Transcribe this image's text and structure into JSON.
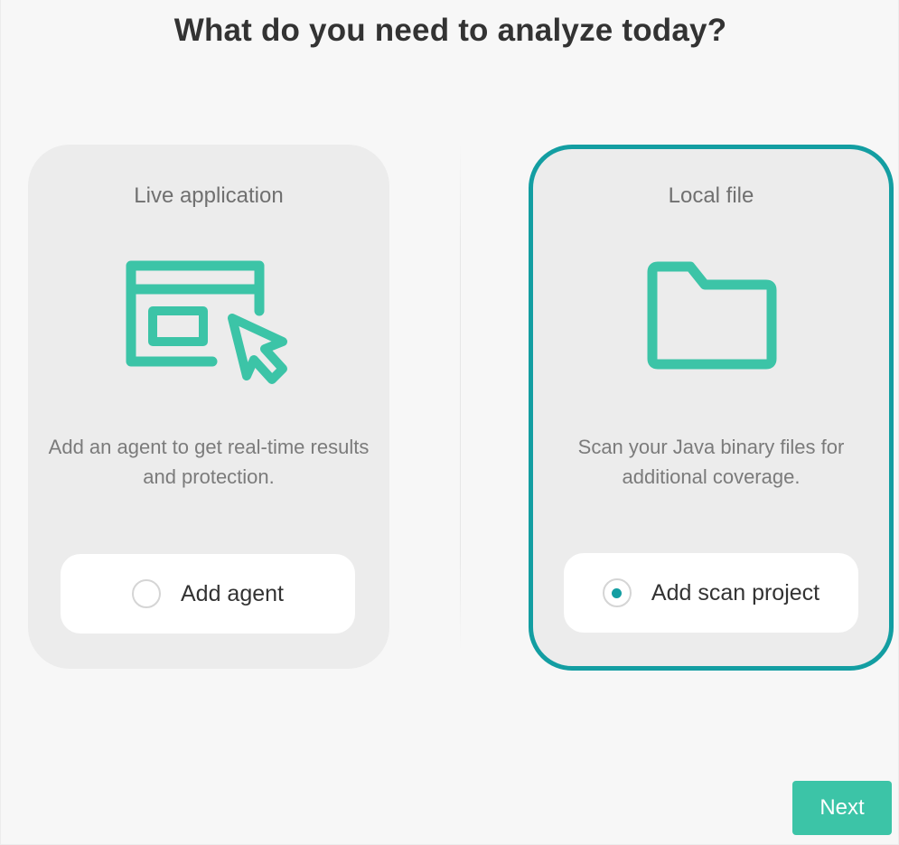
{
  "page": {
    "heading": "What do you need to analyze today?"
  },
  "colors": {
    "accent": "#3cc4a7",
    "selected_border": "#139ea2",
    "card_background": "#ececec",
    "page_background": "#f7f7f7"
  },
  "cards": [
    {
      "id": "live-application",
      "title": "Live application",
      "icon": "browser-window-cursor-icon",
      "description": "Add an agent to get real-time results and protection.",
      "option_label": "Add agent",
      "selected": false
    },
    {
      "id": "local-file",
      "title": "Local file",
      "icon": "folder-icon",
      "description": "Scan your Java binary files for additional coverage.",
      "option_label": "Add scan project",
      "selected": true
    }
  ],
  "footer": {
    "next_label": "Next"
  }
}
